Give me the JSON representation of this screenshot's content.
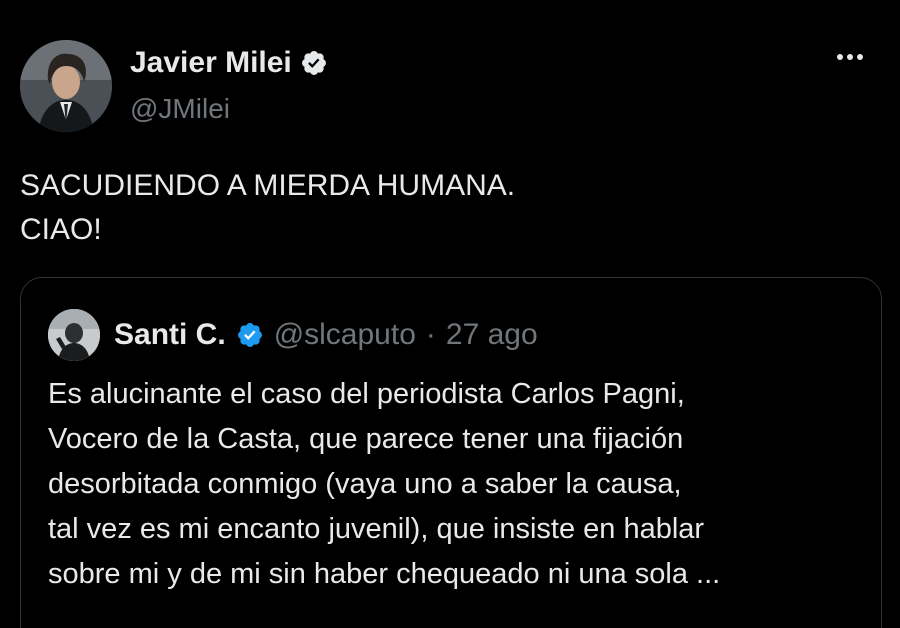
{
  "author": {
    "name": "Javier Milei",
    "handle": "@JMilei",
    "verified": true
  },
  "tweet": {
    "lines": [
      "SACUDIENDO A MIERDA HUMANA.",
      "CIAO!"
    ]
  },
  "quoted_tweet": {
    "name": "Santi C.",
    "handle": "@slcaputo",
    "separator": "·",
    "date": "27 ago",
    "verified": true,
    "lines": [
      "Es alucinante el caso del periodista Carlos Pagni,",
      "Vocero de la Casta, que parece tener una fijación",
      "desorbitada conmigo (vaya uno a saber la causa,",
      "tal vez es mi encanto juvenil), que insiste en hablar",
      "sobre mi y de mi sin haber chequeado ni una sola ..."
    ]
  },
  "icons": {
    "verified": "verified-badge-icon",
    "more": "more-options-icon"
  },
  "colors": {
    "background": "#000000",
    "text": "#e7e9ea",
    "muted": "#71767b",
    "verified": "#1d9bf0",
    "border": "#2f3336"
  }
}
